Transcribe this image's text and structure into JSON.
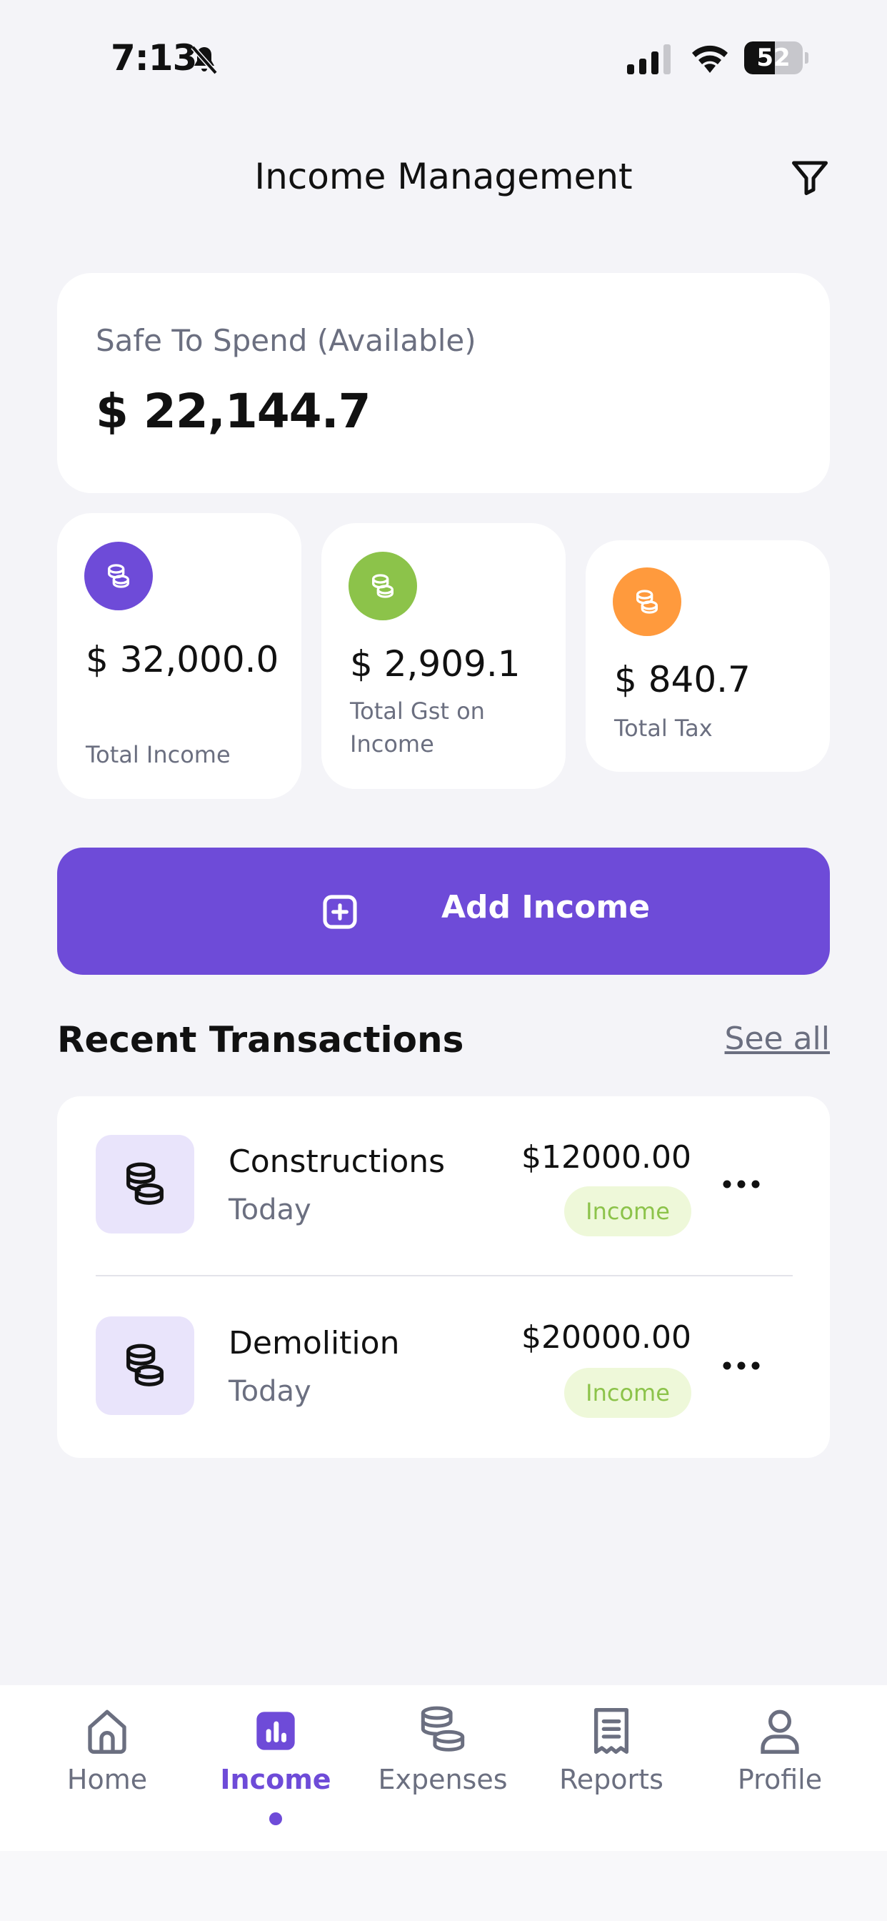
{
  "status_bar": {
    "time": "7:13",
    "battery": "52",
    "battery_level": 0.52
  },
  "header": {
    "title": "Income Management",
    "filter_icon": "filter-icon"
  },
  "safe_to_spend": {
    "label": "Safe To Spend (Available)",
    "amount": "$ 22,144.7"
  },
  "stats": [
    {
      "value": "$ 32,000.0",
      "label": "Total Income",
      "color": "#6e4bd8",
      "icon": "coins-icon"
    },
    {
      "value": "$ 2,909.1",
      "label": "Total Gst on Income",
      "color": "#8cc34a",
      "icon": "coins-icon"
    },
    {
      "value": "$ 840.7",
      "label": "Total Tax",
      "color": "#ff9a3d",
      "icon": "coins-icon"
    }
  ],
  "add_income": {
    "label": "Add Income",
    "icon": "plus-square-icon"
  },
  "recent": {
    "title": "Recent Transactions",
    "see_all": "See all",
    "transactions": [
      {
        "name": "Constructions",
        "date": "Today",
        "amount": "$12000.00",
        "badge": "Income"
      },
      {
        "name": "Demolition",
        "date": "Today",
        "amount": "$20000.00",
        "badge": "Income"
      }
    ]
  },
  "nav": {
    "items": [
      {
        "label": "Home",
        "icon": "home-icon"
      },
      {
        "label": "Income",
        "icon": "income-chart-icon",
        "active": true
      },
      {
        "label": "Expenses",
        "icon": "coins-icon"
      },
      {
        "label": "Reports",
        "icon": "receipt-icon"
      },
      {
        "label": "Profile",
        "icon": "user-icon"
      }
    ]
  },
  "colors": {
    "accent": "#6e4bd8",
    "green": "#8cc34a",
    "orange": "#ff9a3d",
    "muted_text": "#6b6f80",
    "background": "#f4f4f8"
  }
}
